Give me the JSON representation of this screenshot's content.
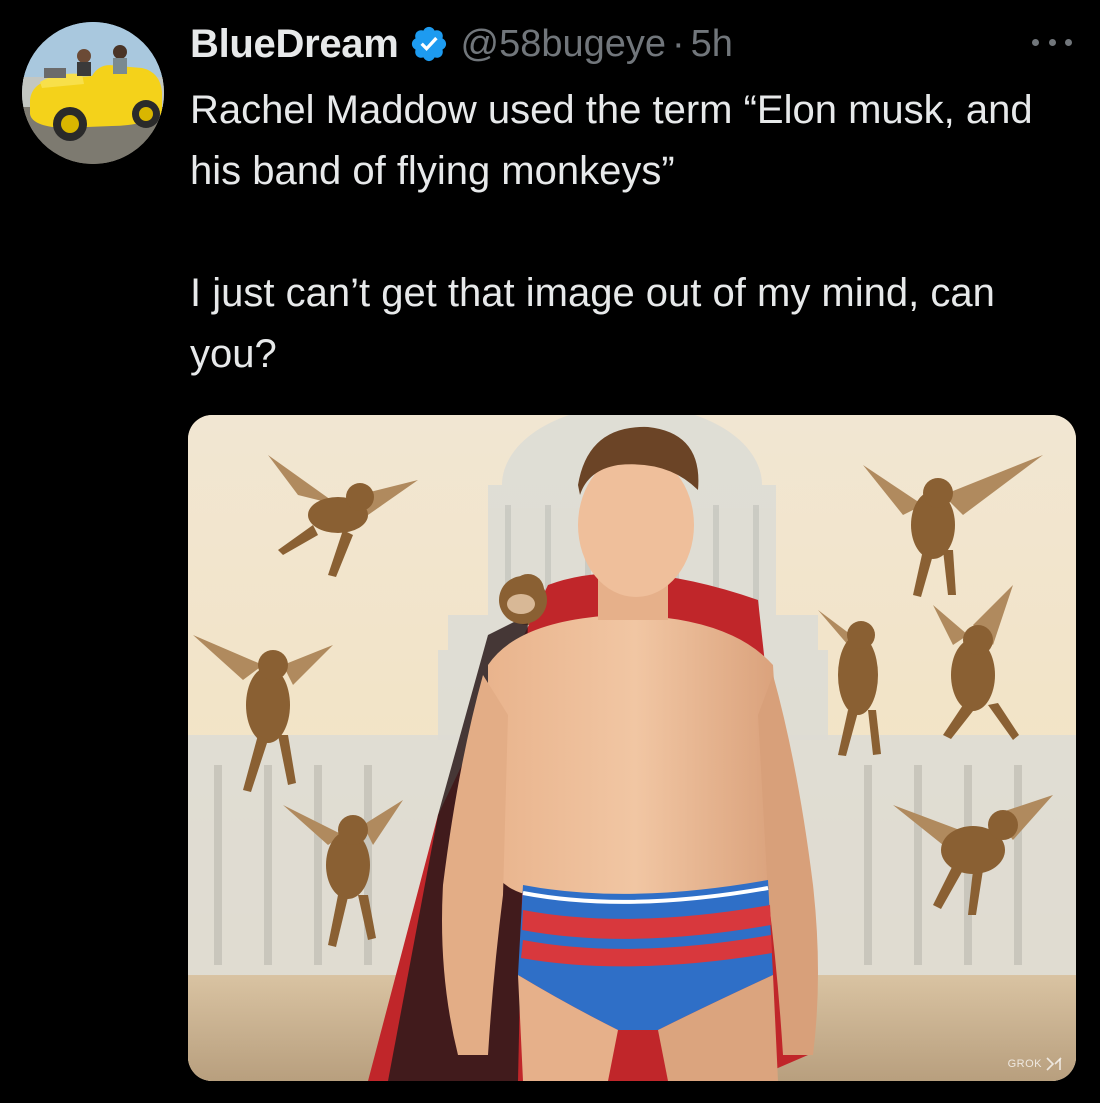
{
  "author": {
    "display_name": "BlueDream",
    "verified_icon": "verified-badge-icon",
    "handle": "@58bugeye",
    "separator": "·",
    "time": "5h",
    "avatar_icon": "avatar-yellow-car"
  },
  "menu": {
    "icon": "more-options-icon"
  },
  "tweet": {
    "paragraphs": [
      "Rachel Maddow used the term “Elon musk, and his band of flying monkeys”",
      "I just can’t get that image out of my mind, can you?"
    ]
  },
  "media": {
    "watermark": "GROK"
  },
  "colors": {
    "background": "#000000",
    "text": "#e7e9ea",
    "secondary_text": "#71767b",
    "verified": "#1d9bf0"
  }
}
